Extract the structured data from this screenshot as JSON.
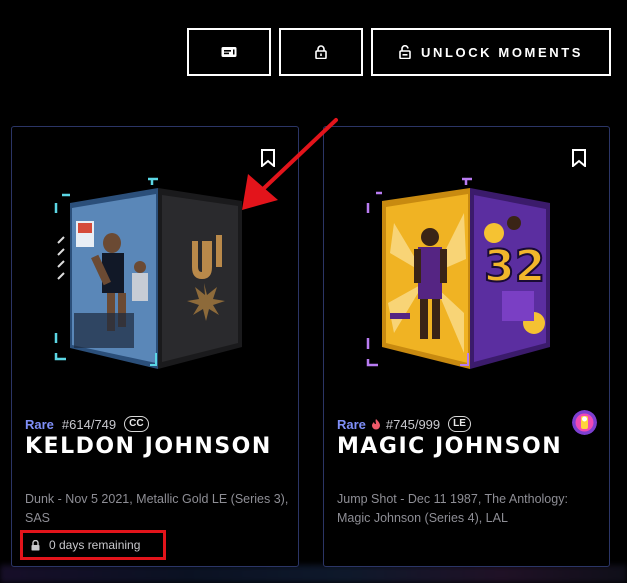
{
  "toolbar": {
    "card_icon": "card-icon",
    "lock_icon": "lock-icon",
    "unlock_label": "UNLOCK MOMENTS",
    "unlock_icon": "unlock-icon"
  },
  "cards": [
    {
      "rarity": "Rare",
      "serial": "#614/749",
      "badge": "CC",
      "player_name": "KELDON JOHNSON",
      "description": "Dunk - Nov 5 2021, Metallic Gold LE (Series 3), SAS",
      "lock_status": "0 days remaining",
      "team_color": "#c4ced4"
    },
    {
      "rarity": "Rare",
      "serial": "#745/999",
      "badge": "LE",
      "player_name": "MAGIC JOHNSON",
      "description": "Jump Shot - Dec 11 1987, The Anthology: Magic Johnson (Series 4), LAL",
      "team_color": "#fdb927"
    }
  ],
  "colors": {
    "rarity": "#7f8ff7",
    "card_border": "#2b3566",
    "highlight_red": "#e3141b",
    "annotation_arrow": "#e3141b"
  }
}
